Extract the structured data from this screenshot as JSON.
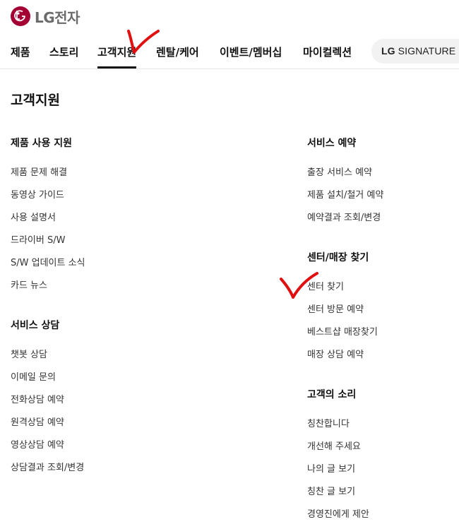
{
  "brand": {
    "name": "LG전자",
    "color": "#a50034"
  },
  "nav": {
    "items": [
      {
        "label": "제품"
      },
      {
        "label": "스토리"
      },
      {
        "label": "고객지원",
        "active": true
      },
      {
        "label": "렌탈/케어"
      },
      {
        "label": "이벤트/멤버십"
      },
      {
        "label": "마이컬렉션"
      }
    ],
    "signature": {
      "brand": "LG",
      "label": "SIGNATURE"
    }
  },
  "page": {
    "title": "고객지원"
  },
  "sections": {
    "product_support": {
      "title": "제품 사용 지원",
      "links": [
        "제품 문제 해결",
        "동영상 가이드",
        "사용 설명서",
        "드라이버 S/W",
        "S/W 업데이트 소식",
        "카드 뉴스"
      ]
    },
    "service_consult": {
      "title": "서비스 상담",
      "links": [
        "챗봇 상담",
        "이메일 문의",
        "전화상담 예약",
        "원격상담 예약",
        "영상상담 예약",
        "상담결과 조회/변경"
      ]
    },
    "service_reservation": {
      "title": "서비스 예약",
      "links": [
        "출장 서비스 예약",
        "제품 설치/철거 예약",
        "예약결과 조회/변경"
      ]
    },
    "center_store": {
      "title": "센터/매장 찾기",
      "links": [
        "센터 찾기",
        "센터 방문 예약",
        "베스트샵 매장찾기",
        "매장 상담 예약"
      ]
    },
    "customer_voice": {
      "title": "고객의 소리",
      "links": [
        "칭찬합니다",
        "개선해 주세요",
        "나의 글 보기",
        "칭찬 글 보기",
        "경영진에게 제안"
      ]
    }
  },
  "annotations": {
    "checkmark_color": "#e01010"
  }
}
